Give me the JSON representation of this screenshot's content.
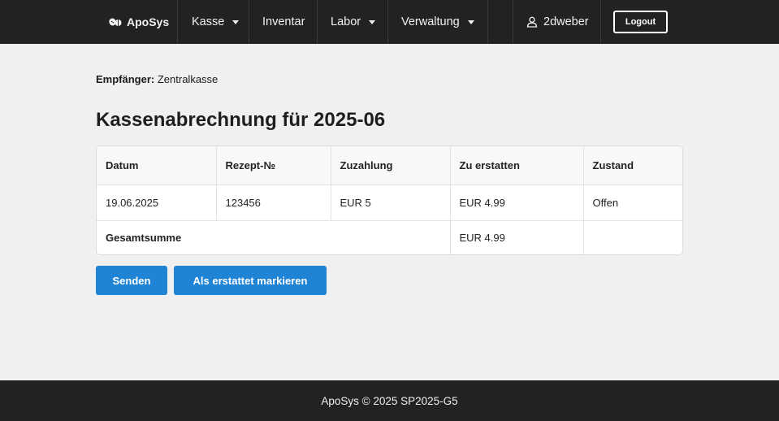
{
  "nav": {
    "brand": "ApoSys",
    "items": [
      {
        "label": "Kasse",
        "dropdown": true
      },
      {
        "label": "Inventar",
        "dropdown": false
      },
      {
        "label": "Labor",
        "dropdown": true
      },
      {
        "label": "Verwaltung",
        "dropdown": true
      }
    ],
    "user": "2dweber",
    "logout_label": "Logout"
  },
  "recipient": {
    "label": "Empfänger:",
    "value": "Zentralkasse"
  },
  "title": "Kassenabrechnung für 2025-06",
  "table": {
    "headers": [
      "Datum",
      "Rezept-№",
      "Zuzahlung",
      "Zu erstatten",
      "Zustand"
    ],
    "rows": [
      [
        "19.06.2025",
        "123456",
        "EUR 5",
        "EUR 4.99",
        "Offen"
      ]
    ],
    "total": {
      "label": "Gesamtsumme",
      "value": "EUR 4.99",
      "status": ""
    }
  },
  "actions": {
    "send_label": "Senden",
    "mark_label": "Als erstattet markieren"
  },
  "footer": {
    "text": "ApoSys © 2025 SP2025-G5"
  },
  "colors": {
    "navbar": "#222222",
    "primary_button": "#1f83d6",
    "background": "#f0f0f0"
  }
}
